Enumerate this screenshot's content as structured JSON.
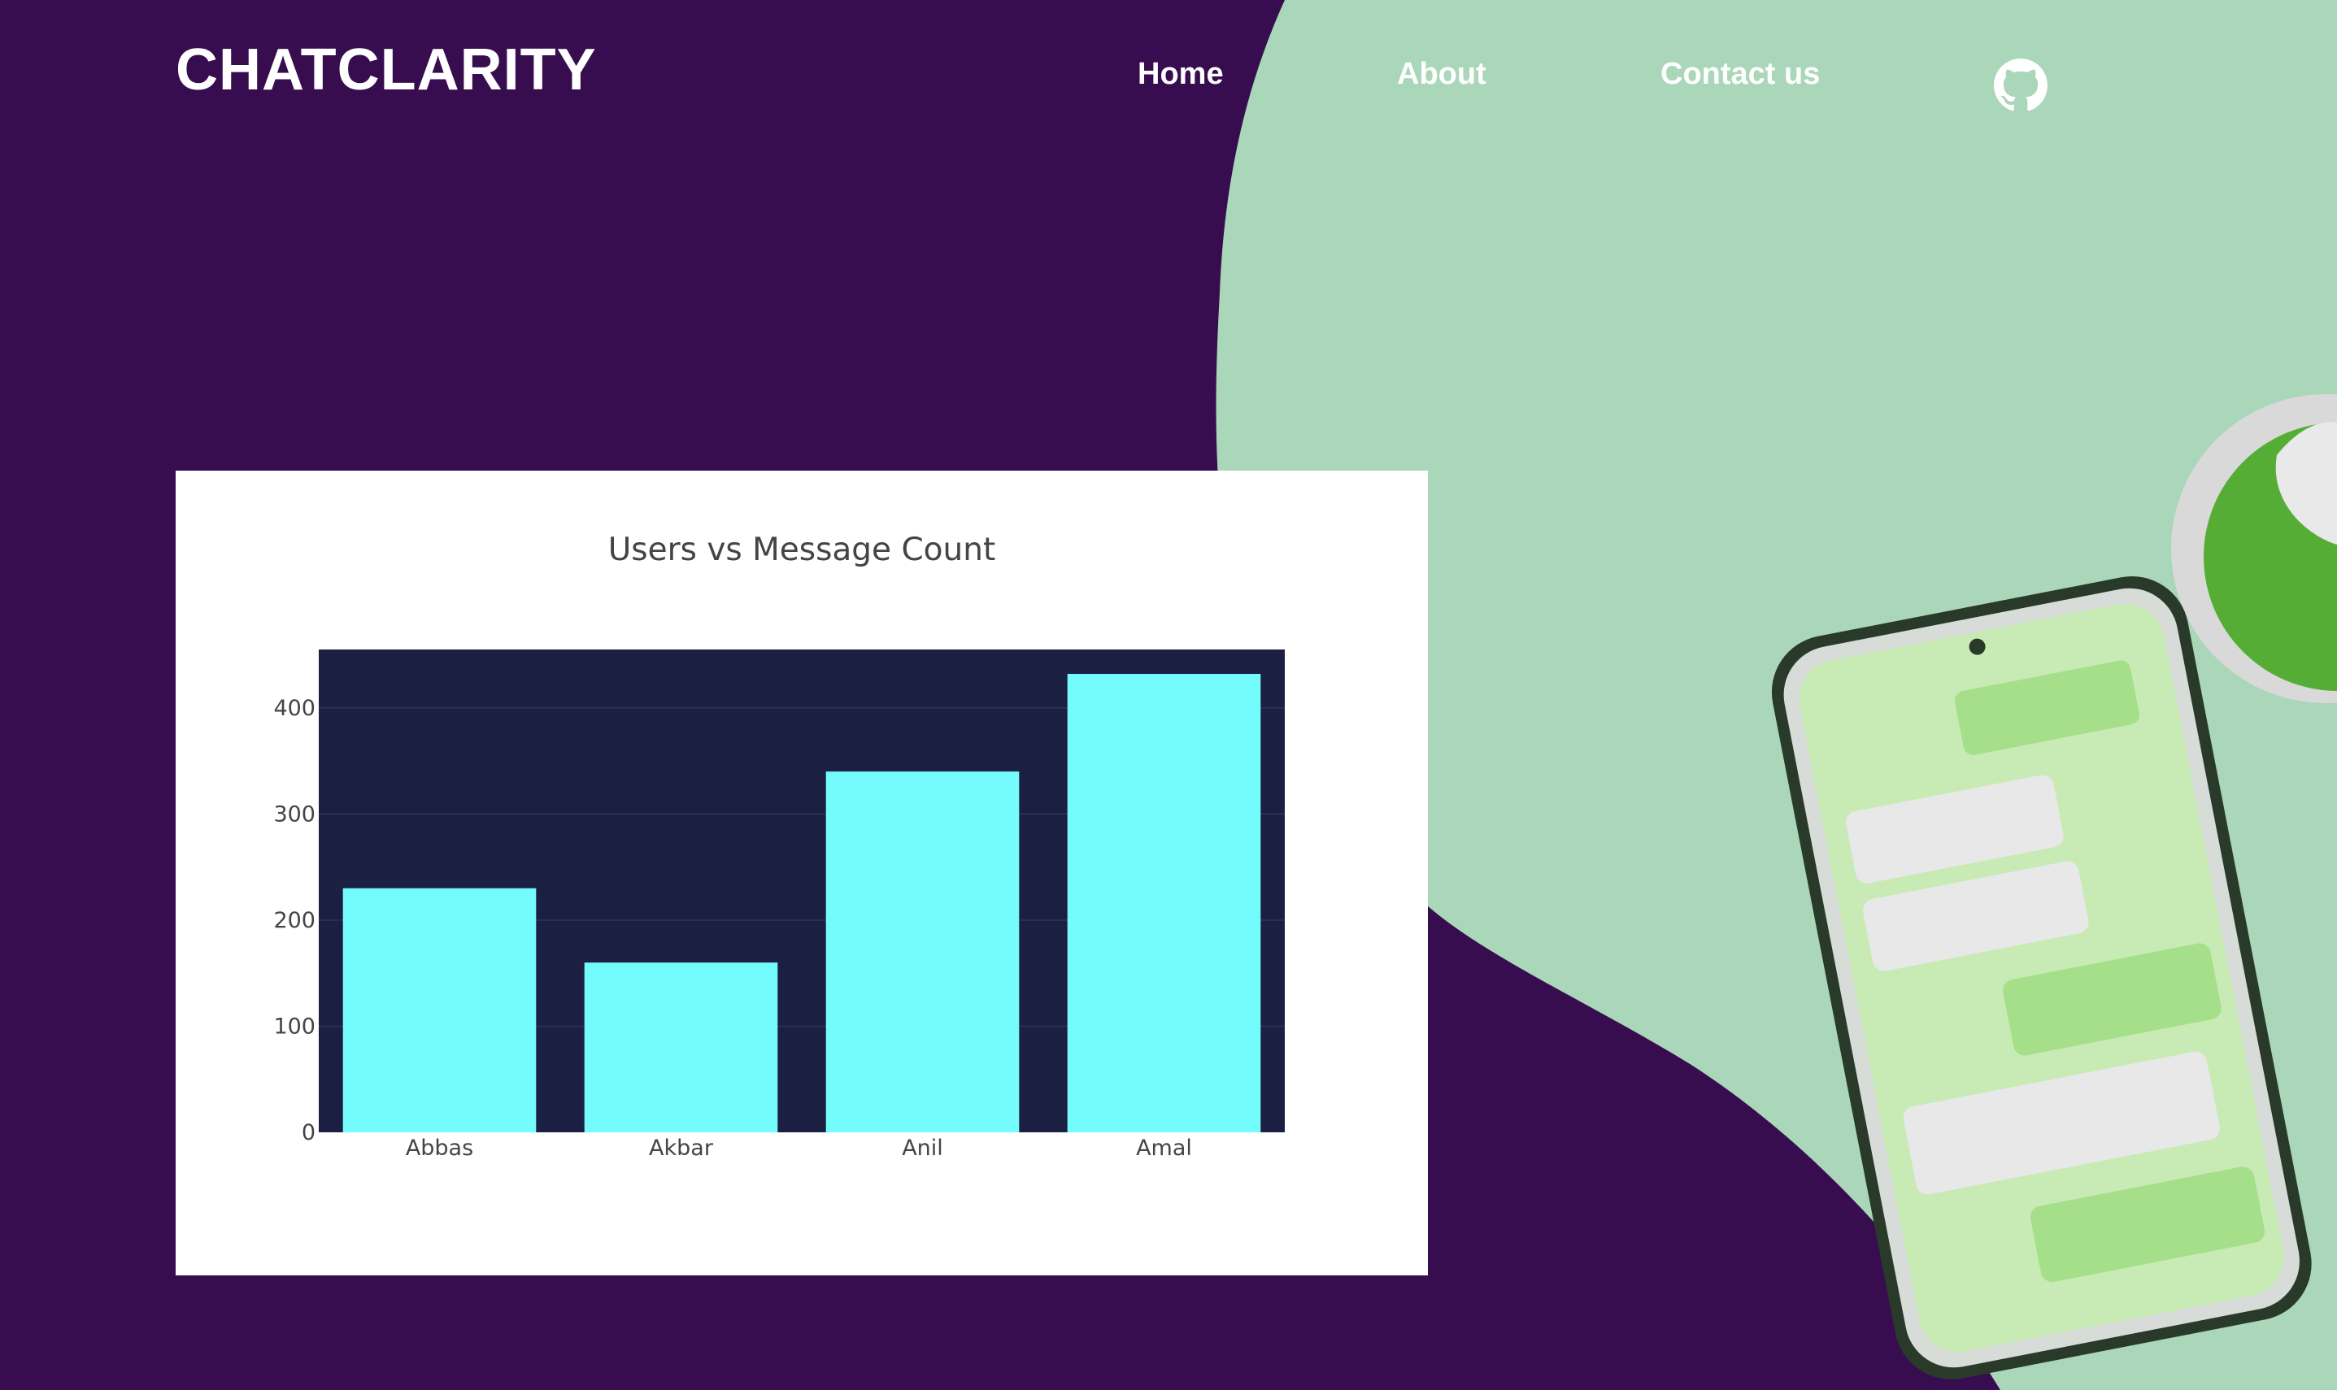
{
  "brand": {
    "name": "CHATCLARITY"
  },
  "nav": {
    "items": [
      {
        "label": "Home"
      },
      {
        "label": "About"
      },
      {
        "label": "Contact us"
      }
    ],
    "github_icon": "github-icon"
  },
  "colors": {
    "background": "#380d4f",
    "blob": "#aad6b9",
    "plot_bg": "#1b1f42",
    "bar": "#74fbfc",
    "phone_screen": "#c8ebb6",
    "bubble_green": "#a6df8a",
    "bubble_gray": "#e8e8e8"
  },
  "chart_data": {
    "type": "bar",
    "title": "Users vs Message Count",
    "categories": [
      "Abbas",
      "Akbar",
      "Anil",
      "Amal"
    ],
    "values": [
      230,
      160,
      340,
      432
    ],
    "ylim": [
      0,
      455
    ],
    "yticks": [
      0,
      100,
      200,
      300,
      400
    ],
    "xlabel": "",
    "ylabel": "",
    "grid": true
  }
}
